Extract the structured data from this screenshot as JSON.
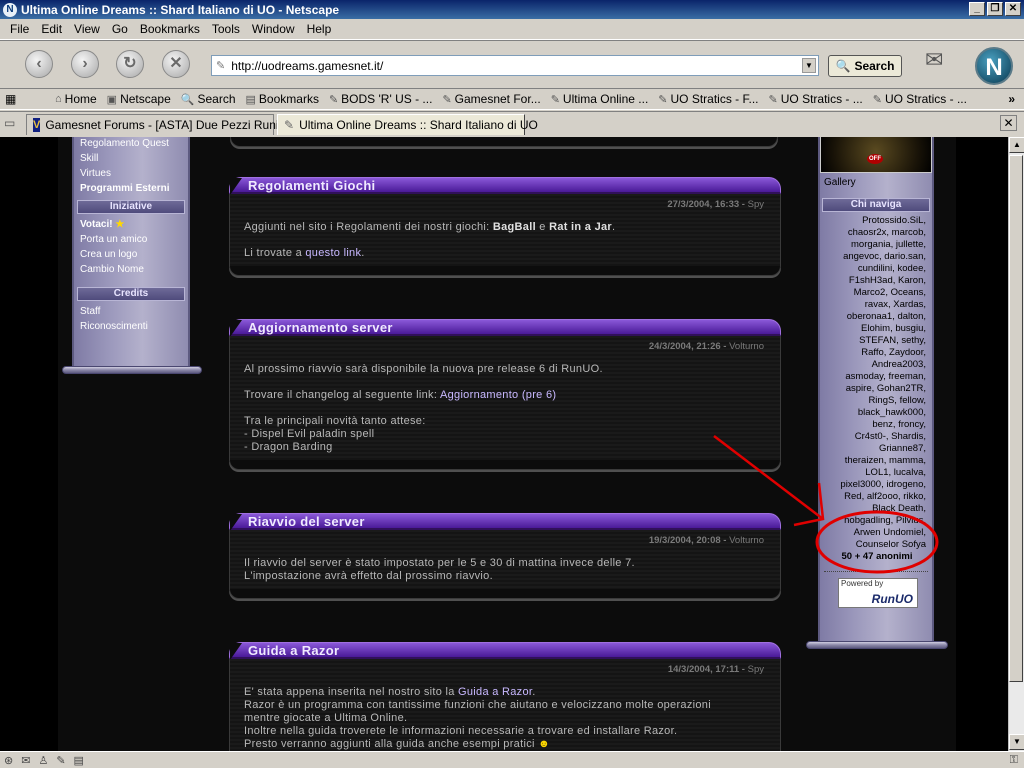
{
  "window": {
    "title": "Ultima Online Dreams :: Shard Italiano di UO - Netscape",
    "app_icon": "N"
  },
  "menu": [
    "File",
    "Edit",
    "View",
    "Go",
    "Bookmarks",
    "Tools",
    "Window",
    "Help"
  ],
  "nav": {
    "url": "http://uodreams.gamesnet.it/",
    "search_label": "Search",
    "logo": "N"
  },
  "personal_toolbar": {
    "items": [
      "Home",
      "Netscape",
      "Search",
      "Bookmarks",
      "BODS 'R' US - ...",
      "Gamesnet For...",
      "Ultima Online ...",
      "UO Stratics - F...",
      "UO Stratics - ...",
      "UO Stratics - ..."
    ],
    "overflow": "»"
  },
  "tabs": [
    {
      "label": "Gamesnet Forums - [ASTA] Due Pezzi Runici",
      "active": false
    },
    {
      "label": "Ultima Online Dreams :: Shard Italiano di UO",
      "active": true
    }
  ],
  "left_nav": {
    "links_top": [
      "Regolamento Quest",
      "Skill",
      "Virtues"
    ],
    "link_bold": "Programmi Esterni",
    "sections": [
      {
        "title": "Iniziative",
        "links": [
          "Votaci!",
          "Porta un amico",
          "Crea un logo",
          "Cambio Nome"
        ]
      },
      {
        "title": "Credits",
        "links": [
          "Staff",
          "Riconoscimenti"
        ]
      }
    ]
  },
  "right_col": {
    "gallery_label": "Gallery",
    "off_badge": "OFF",
    "who_title": "Chi naviga",
    "who_list": [
      "Protossido.SiL,",
      "chaosr2x, marcob,",
      "morgania, jullette,",
      "angevoc, dario.san,",
      "cundilini, kodee,",
      "F1shH3ad, Karon,",
      "Marco2, Oceans,",
      "ravax, Xardas,",
      "oberonaa1, dalton,",
      "Elohim, busgiu,",
      "STEFAN, sethy,",
      "Raffo, Zaydoor,",
      "Andrea2003,",
      "asmoday, freeman,",
      "aspire, Gohan2TR,",
      "RingS, fellow,",
      "black_hawk000,",
      "benz, froncy,",
      "Cr4st0-, Shardis,",
      "Grianne87,",
      "theraizen, mamma,",
      "LOL1, lucalva,",
      "pixel3000, idrogeno,",
      "Red, alf2ooo, rikko,",
      "Black Death,",
      "hobgadling, Pilvius,",
      "Arwen Undomiel,",
      "Counselor Sofya"
    ],
    "who_total": "50 + 47 anonimi",
    "powered_by": "Powered by",
    "runuo": "RunUO"
  },
  "news": [
    {
      "title": "Regolamenti Giochi",
      "date": "27/3/2004, 16:33",
      "author": "Spy",
      "p1_pre": "Aggiunti nel sito i Regolamenti dei nostri giochi: ",
      "p1_b1": "BagBall",
      "p1_mid": " e ",
      "p1_b2": "Rat in a Jar",
      "p1_end": ".",
      "p2_pre": "Li trovate a ",
      "p2_link": "questo link",
      "p2_end": "."
    },
    {
      "title": "Aggiornamento server",
      "date": "24/3/2004, 21:26",
      "author": "Volturno",
      "l1": "Al prossimo riavvio sarà disponibile la nuova pre release 6 di RunUO.",
      "l2_pre": "Trovare il changelog al seguente link: ",
      "l2_link": "Aggiornamento (pre 6)",
      "l3": "Tra le principali novità tanto attese:",
      "l4": "- Dispel Evil paladin spell",
      "l5": "- Dragon Barding"
    },
    {
      "title": "Riavvio del server",
      "date": "19/3/2004, 20:08",
      "author": "Volturno",
      "l1": "Il riavvio del server è stato impostato per le 5 e 30 di mattina invece delle 7.",
      "l2": "L'impostazione avrà effetto dal prossimo riavvio."
    },
    {
      "title": "Guida a Razor",
      "date": "14/3/2004, 17:11",
      "author": "Spy",
      "l1_pre": "E' stata appena inserita nel nostro sito la ",
      "l1_link": "Guida a Razor",
      "l1_end": ".",
      "l2": "Razor è un programma con tantissime funzioni che aiutano e velocizzano molte operazioni",
      "l3": "mentre giocate a Ultima Online.",
      "l4": "Inoltre nella guida troverete le informazioni necessarie a trovare ed installare Razor.",
      "l5": "Presto verranno aggiunti alla guida anche esempi pratici"
    }
  ],
  "meta_sep": " - ",
  "colors": {
    "accent": "#4a1a98",
    "annotation": "#e00000",
    "link": "#c8b8ff"
  }
}
